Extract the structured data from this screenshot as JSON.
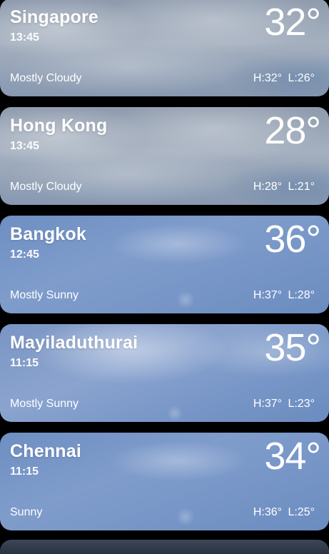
{
  "locations": [
    {
      "city": "Singapore",
      "time": "13:45",
      "temp": "32°",
      "condition": "Mostly Cloudy",
      "hilo": "H:32°  L:26°"
    },
    {
      "city": "Hong Kong",
      "time": "13:45",
      "temp": "28°",
      "condition": "Mostly Cloudy",
      "hilo": "H:28°  L:21°"
    },
    {
      "city": "Bangkok",
      "time": "12:45",
      "temp": "36°",
      "condition": "Mostly Sunny",
      "hilo": "H:37°  L:28°"
    },
    {
      "city": "Mayiladuthurai",
      "time": "11:15",
      "temp": "35°",
      "condition": "Mostly Sunny",
      "hilo": "H:37°  L:23°"
    },
    {
      "city": "Chennai",
      "time": "11:15",
      "temp": "34°",
      "condition": "Sunny",
      "hilo": "H:36°  L:25°"
    }
  ],
  "colors": {
    "cloudy_bg": "#9aa6b7",
    "sunny_bg": "#7695c6",
    "text": "#ffffff",
    "app_background": "#000000"
  }
}
